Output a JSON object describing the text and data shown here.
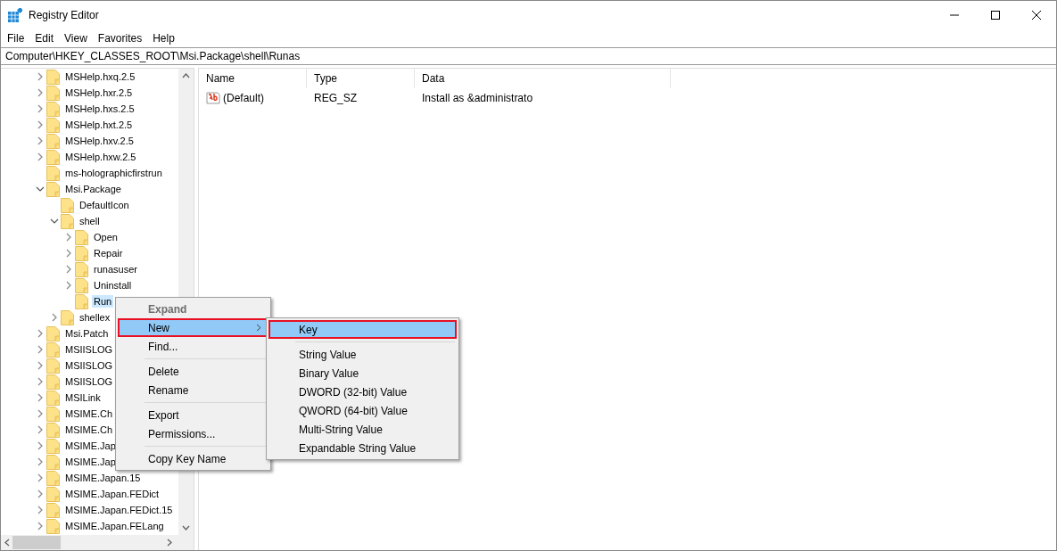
{
  "window": {
    "title": "Registry Editor"
  },
  "menu_bar": [
    "File",
    "Edit",
    "View",
    "Favorites",
    "Help"
  ],
  "address": "Computer\\HKEY_CLASSES_ROOT\\Msi.Package\\shell\\Runas",
  "tree": {
    "items": [
      {
        "label": "MSHelp.hxq.2.5",
        "expandable": true,
        "expanded": false,
        "selected": false
      },
      {
        "label": "MSHelp.hxr.2.5",
        "expandable": true,
        "expanded": false,
        "selected": false
      },
      {
        "label": "MSHelp.hxs.2.5",
        "expandable": true,
        "expanded": false,
        "selected": false
      },
      {
        "label": "MSHelp.hxt.2.5",
        "expandable": true,
        "expanded": false,
        "selected": false
      },
      {
        "label": "MSHelp.hxv.2.5",
        "expandable": true,
        "expanded": false,
        "selected": false
      },
      {
        "label": "MSHelp.hxw.2.5",
        "expandable": true,
        "expanded": false,
        "selected": false
      },
      {
        "label": "ms-holographicfirstrun",
        "expandable": false,
        "expanded": false,
        "selected": false
      },
      {
        "label": "Msi.Package",
        "expandable": true,
        "expanded": true,
        "selected": false,
        "children": [
          {
            "label": "DefaultIcon",
            "expandable": false,
            "expanded": false,
            "selected": false
          },
          {
            "label": "shell",
            "expandable": true,
            "expanded": true,
            "selected": false,
            "children": [
              {
                "label": "Open",
                "expandable": true,
                "expanded": false,
                "selected": false
              },
              {
                "label": "Repair",
                "expandable": true,
                "expanded": false,
                "selected": false
              },
              {
                "label": "runasuser",
                "expandable": true,
                "expanded": false,
                "selected": false
              },
              {
                "label": "Uninstall",
                "expandable": true,
                "expanded": false,
                "selected": false
              },
              {
                "label": "Run",
                "expandable": false,
                "expanded": false,
                "selected": true
              }
            ]
          },
          {
            "label": "shellex",
            "expandable": true,
            "expanded": false,
            "selected": false
          }
        ]
      },
      {
        "label": "Msi.Patch",
        "expandable": true,
        "expanded": false,
        "selected": false
      },
      {
        "label": "MSIISLOG",
        "expandable": true,
        "expanded": false,
        "selected": false
      },
      {
        "label": "MSIISLOG",
        "expandable": true,
        "expanded": false,
        "selected": false
      },
      {
        "label": "MSIISLOG",
        "expandable": true,
        "expanded": false,
        "selected": false
      },
      {
        "label": "MSILink",
        "expandable": true,
        "expanded": false,
        "selected": false
      },
      {
        "label": "MSIME.Ch",
        "expandable": true,
        "expanded": false,
        "selected": false
      },
      {
        "label": "MSIME.Ch",
        "expandable": true,
        "expanded": false,
        "selected": false
      },
      {
        "label": "MSIME.Jap",
        "expandable": true,
        "expanded": false,
        "selected": false
      },
      {
        "label": "MSIME.Jap",
        "expandable": true,
        "expanded": false,
        "selected": false
      },
      {
        "label": "MSIME.Japan.15",
        "expandable": true,
        "expanded": false,
        "selected": false
      },
      {
        "label": "MSIME.Japan.FEDict",
        "expandable": true,
        "expanded": false,
        "selected": false
      },
      {
        "label": "MSIME.Japan.FEDict.15",
        "expandable": true,
        "expanded": false,
        "selected": false
      },
      {
        "label": "MSIME.Japan.FELang",
        "expandable": true,
        "expanded": false,
        "selected": false
      }
    ]
  },
  "values": {
    "columns": [
      "Name",
      "Type",
      "Data"
    ],
    "rows": [
      {
        "name": "(Default)",
        "type": "REG_SZ",
        "data": "Install as &administrato"
      }
    ]
  },
  "context_menu": {
    "items": [
      {
        "kind": "item",
        "label": "Expand",
        "default": true,
        "disabled": true,
        "selected": false,
        "submenu": false,
        "outlined": false
      },
      {
        "kind": "item",
        "label": "New",
        "default": false,
        "disabled": false,
        "selected": true,
        "submenu": true,
        "outlined": true
      },
      {
        "kind": "item",
        "label": "Find...",
        "default": false,
        "disabled": false,
        "selected": false,
        "submenu": false,
        "outlined": false
      },
      {
        "kind": "separator"
      },
      {
        "kind": "item",
        "label": "Delete",
        "default": false,
        "disabled": false,
        "selected": false,
        "submenu": false,
        "outlined": false
      },
      {
        "kind": "item",
        "label": "Rename",
        "default": false,
        "disabled": false,
        "selected": false,
        "submenu": false,
        "outlined": false
      },
      {
        "kind": "separator"
      },
      {
        "kind": "item",
        "label": "Export",
        "default": false,
        "disabled": false,
        "selected": false,
        "submenu": false,
        "outlined": false
      },
      {
        "kind": "item",
        "label": "Permissions...",
        "default": false,
        "disabled": false,
        "selected": false,
        "submenu": false,
        "outlined": false
      },
      {
        "kind": "separator"
      },
      {
        "kind": "item",
        "label": "Copy Key Name",
        "default": false,
        "disabled": false,
        "selected": false,
        "submenu": false,
        "outlined": false
      }
    ]
  },
  "submenu": {
    "items": [
      {
        "kind": "item",
        "label": "Key",
        "selected": true,
        "outlined": true
      },
      {
        "kind": "separator"
      },
      {
        "kind": "item",
        "label": "String Value",
        "selected": false,
        "outlined": false
      },
      {
        "kind": "item",
        "label": "Binary Value",
        "selected": false,
        "outlined": false
      },
      {
        "kind": "item",
        "label": "DWORD (32-bit) Value",
        "selected": false,
        "outlined": false
      },
      {
        "kind": "item",
        "label": "QWORD (64-bit) Value",
        "selected": false,
        "outlined": false
      },
      {
        "kind": "item",
        "label": "Multi-String Value",
        "selected": false,
        "outlined": false
      },
      {
        "kind": "item",
        "label": "Expandable String Value",
        "selected": false,
        "outlined": false
      }
    ]
  }
}
